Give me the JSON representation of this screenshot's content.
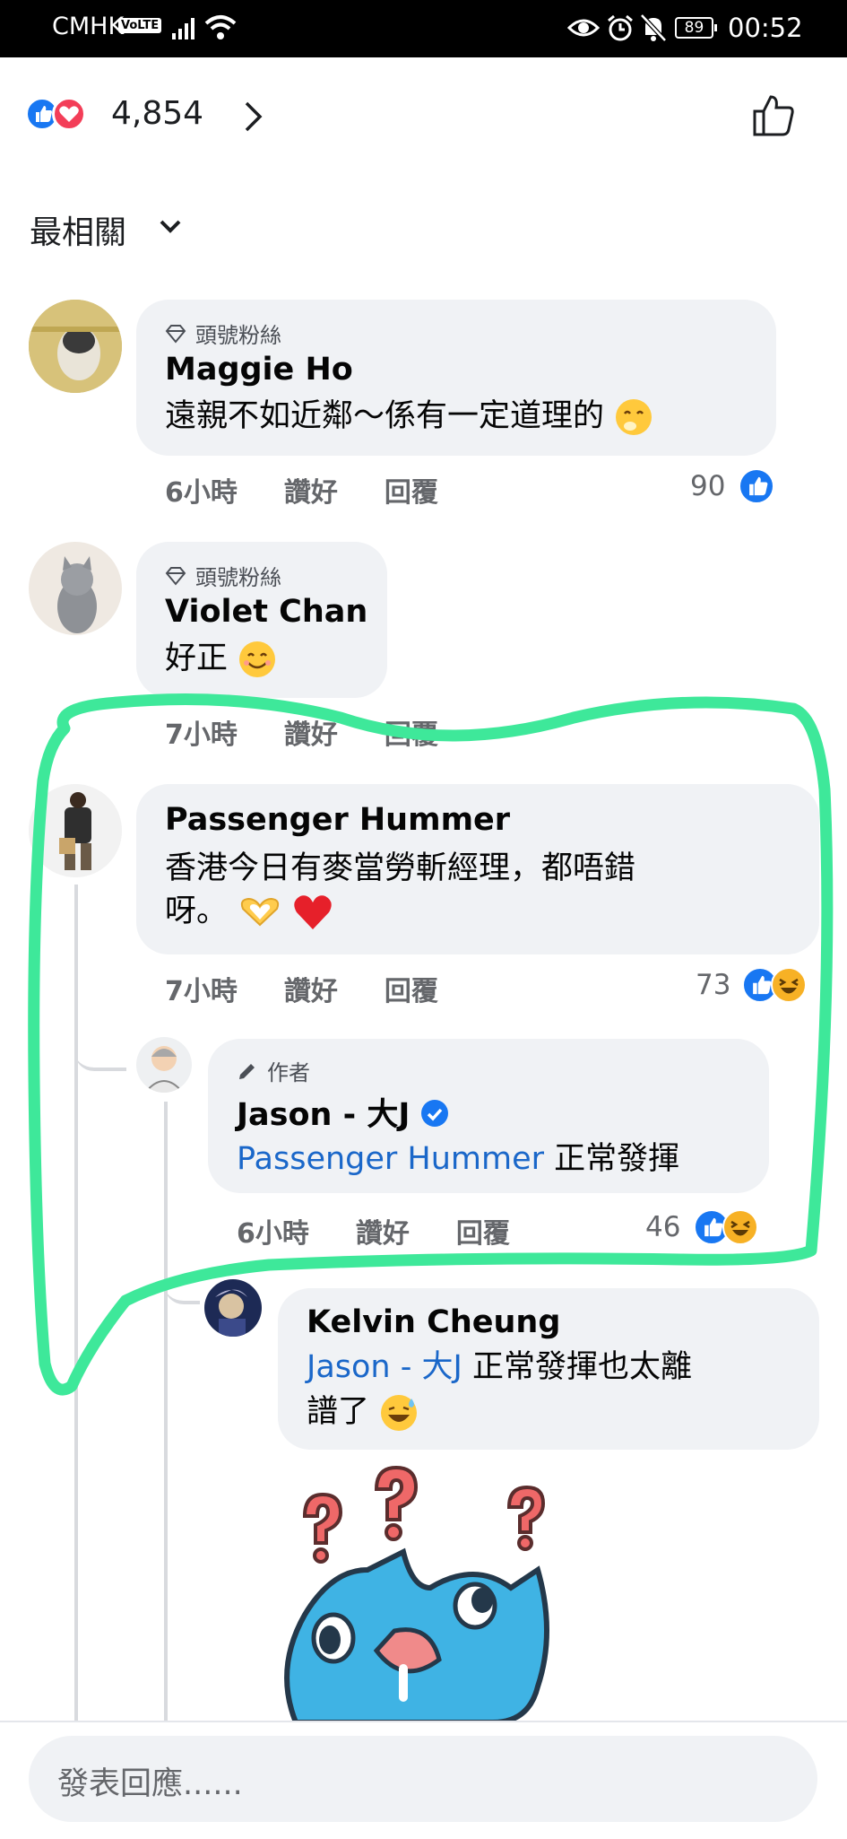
{
  "status_bar": {
    "carrier": "CMHK",
    "volte": "VoLTE",
    "battery": "89",
    "time": "00:52"
  },
  "reactions": {
    "total": "4,854"
  },
  "sort": {
    "label": "最相關"
  },
  "comments": [
    {
      "badge": "頭號粉絲",
      "name": "Maggie Ho",
      "text": "遠親不如近鄰～係有一定道理的",
      "time": "6小時",
      "like": "讚好",
      "reply": "回覆",
      "count": "90"
    },
    {
      "badge": "頭號粉絲",
      "name": "Violet Chan",
      "text": "好正",
      "time": "7小時",
      "like": "讚好",
      "reply": "回覆"
    },
    {
      "name": "Passenger Hummer",
      "text_line1": "香港今日有麥當勞斬經理，都唔錯",
      "text_line2": "呀。",
      "time": "7小時",
      "like": "讚好",
      "reply": "回覆",
      "count": "73",
      "replies": [
        {
          "badge": "作者",
          "name": "Jason - 大J",
          "mention": "Passenger Hummer",
          "text": " 正常發揮",
          "time": "6小時",
          "like": "讚好",
          "reply": "回覆",
          "count": "46"
        },
        {
          "name": "Kelvin Cheung",
          "mention": "Jason - 大J",
          "text_line1": " 正常發揮也太離",
          "text_line2": "譜了"
        }
      ]
    }
  ],
  "composer": {
    "placeholder": "發表回應......"
  },
  "colors": {
    "like_blue": "#1877f2",
    "love_red": "#f33e58",
    "mention_blue": "#1a67c9",
    "highlight_green": "#3ee89a",
    "bubble_gray": "#f0f2f5"
  }
}
